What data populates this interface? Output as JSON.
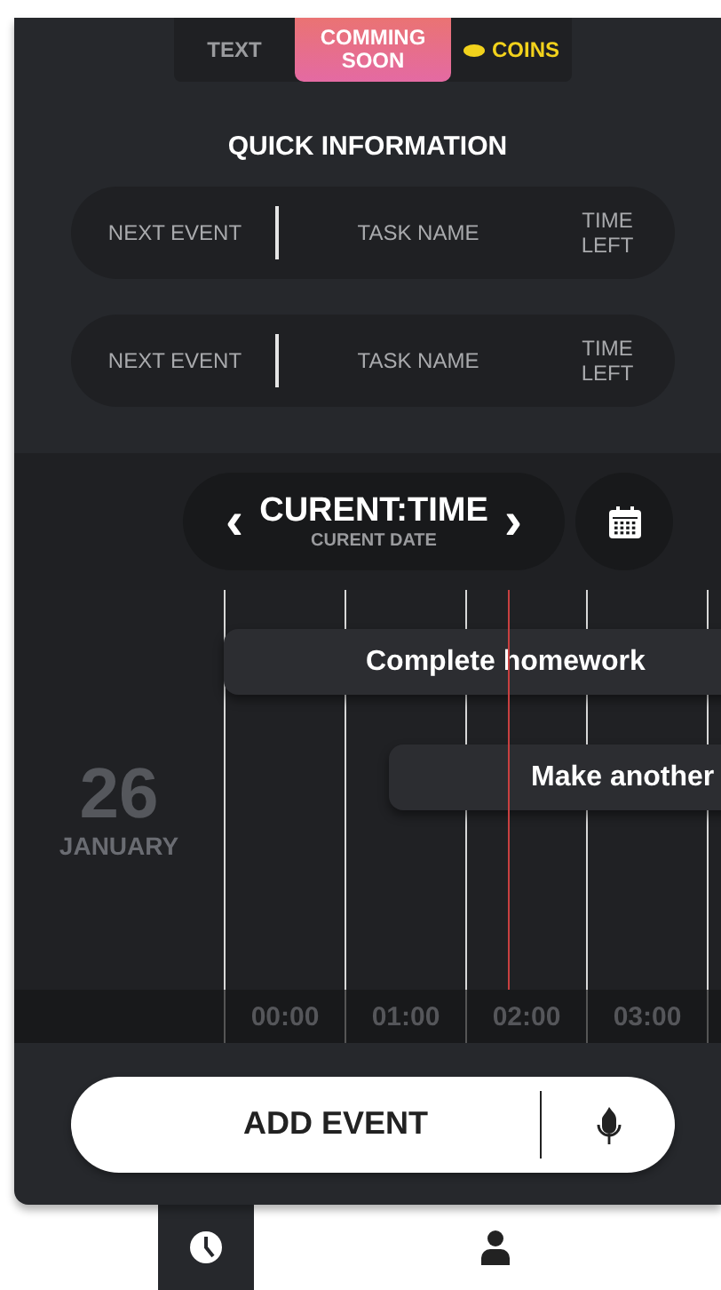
{
  "top_tabs": [
    {
      "label": "TEXT",
      "selected": false,
      "kind": "text"
    },
    {
      "label": "COMMING SOON",
      "selected": true,
      "kind": "text"
    },
    {
      "label": "COINS",
      "selected": false,
      "kind": "coins"
    }
  ],
  "quick_information": {
    "title": "QUICK INFORMATION",
    "rows": [
      {
        "next_event": "NEXT EVENT",
        "task_name": "TASK NAME",
        "time_left": "TIME LEFT"
      },
      {
        "next_event": "NEXT EVENT",
        "task_name": "TASK NAME",
        "time_left": "TIME LEFT"
      }
    ]
  },
  "time_nav": {
    "prev": "‹",
    "time": "CURENT:TIME",
    "date": "CURENT DATE",
    "next": "›"
  },
  "timeline": {
    "day": "26",
    "month": "JANUARY",
    "events": [
      {
        "title": "Complete homework"
      },
      {
        "title": "Make another"
      }
    ],
    "hours": [
      "00:00",
      "01:00",
      "02:00",
      "03:00"
    ]
  },
  "add_event": {
    "label": "ADD EVENT"
  },
  "bottom_nav": [
    {
      "kind": "clock",
      "selected": true
    },
    {
      "kind": "person",
      "selected": false
    }
  ]
}
